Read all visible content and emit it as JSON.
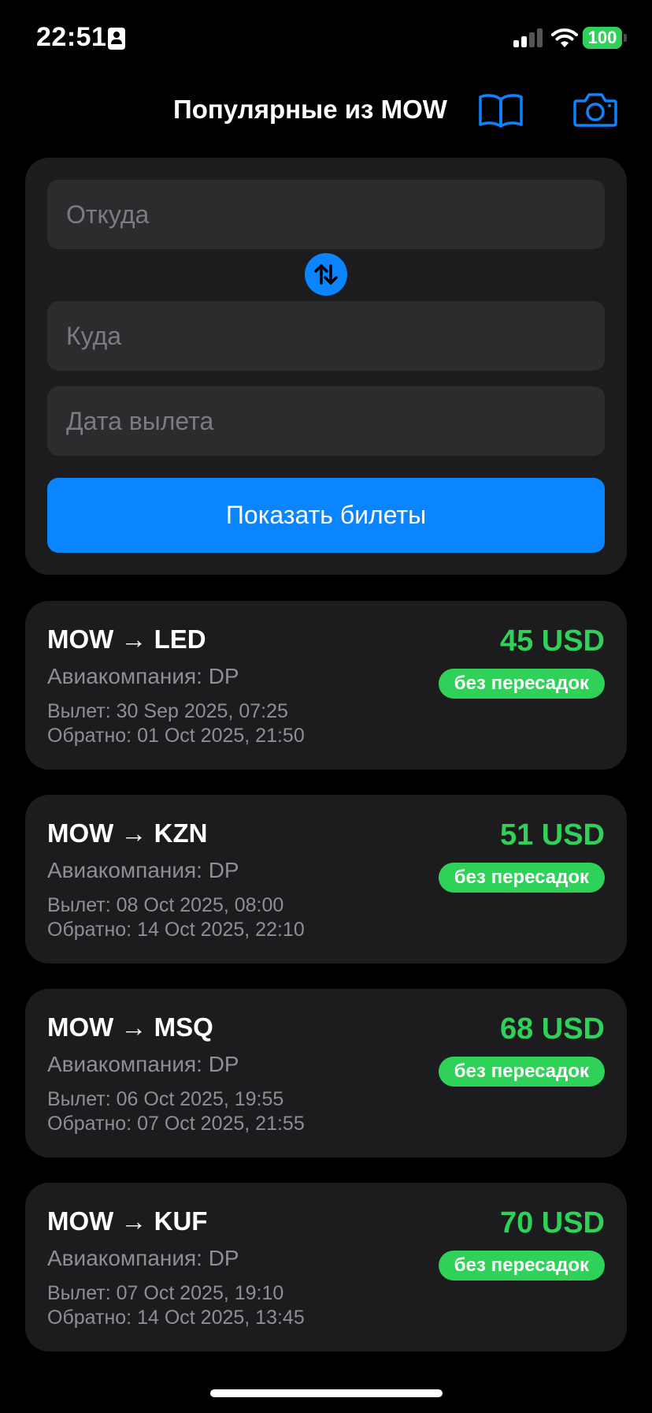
{
  "status_bar": {
    "time": "22:51",
    "battery": "100",
    "colors": {
      "battery_fill": "#30d158"
    }
  },
  "header": {
    "title": "Популярные из MOW",
    "icons": [
      "book-icon",
      "camera-icon"
    ],
    "accent_color": "#0a84ff"
  },
  "search": {
    "from_placeholder": "Откуда",
    "to_placeholder": "Куда",
    "date_placeholder": "Дата вылета",
    "swap_icon": "swap-arrows-icon",
    "submit_label": "Показать билеты"
  },
  "tickets": [
    {
      "route": "MOW → LED",
      "airline": "Авиакомпания: DP",
      "depart": "Вылет: 30 Sep 2025, 07:25",
      "return": "Обратно: 01 Oct 2025, 21:50",
      "price": "45 USD",
      "badge": "без пересадок"
    },
    {
      "route": "MOW → KZN",
      "airline": "Авиакомпания: DP",
      "depart": "Вылет: 08 Oct 2025, 08:00",
      "return": "Обратно: 14 Oct 2025, 22:10",
      "price": "51 USD",
      "badge": "без пересадок"
    },
    {
      "route": "MOW → MSQ",
      "airline": "Авиакомпания: DP",
      "depart": "Вылет: 06 Oct 2025, 19:55",
      "return": "Обратно: 07 Oct 2025, 21:55",
      "price": "68 USD",
      "badge": "без пересадок"
    },
    {
      "route": "MOW → KUF",
      "airline": "Авиакомпания: DP",
      "depart": "Вылет: 07 Oct 2025, 19:10",
      "return": "Обратно: 14 Oct 2025, 13:45",
      "price": "70 USD",
      "badge": "без пересадок"
    }
  ],
  "colors": {
    "background": "#000000",
    "card": "#1c1c1e",
    "field": "#2c2c2e",
    "price": "#30d158",
    "badge": "#30d158",
    "secondary_text": "#8e8e93"
  }
}
